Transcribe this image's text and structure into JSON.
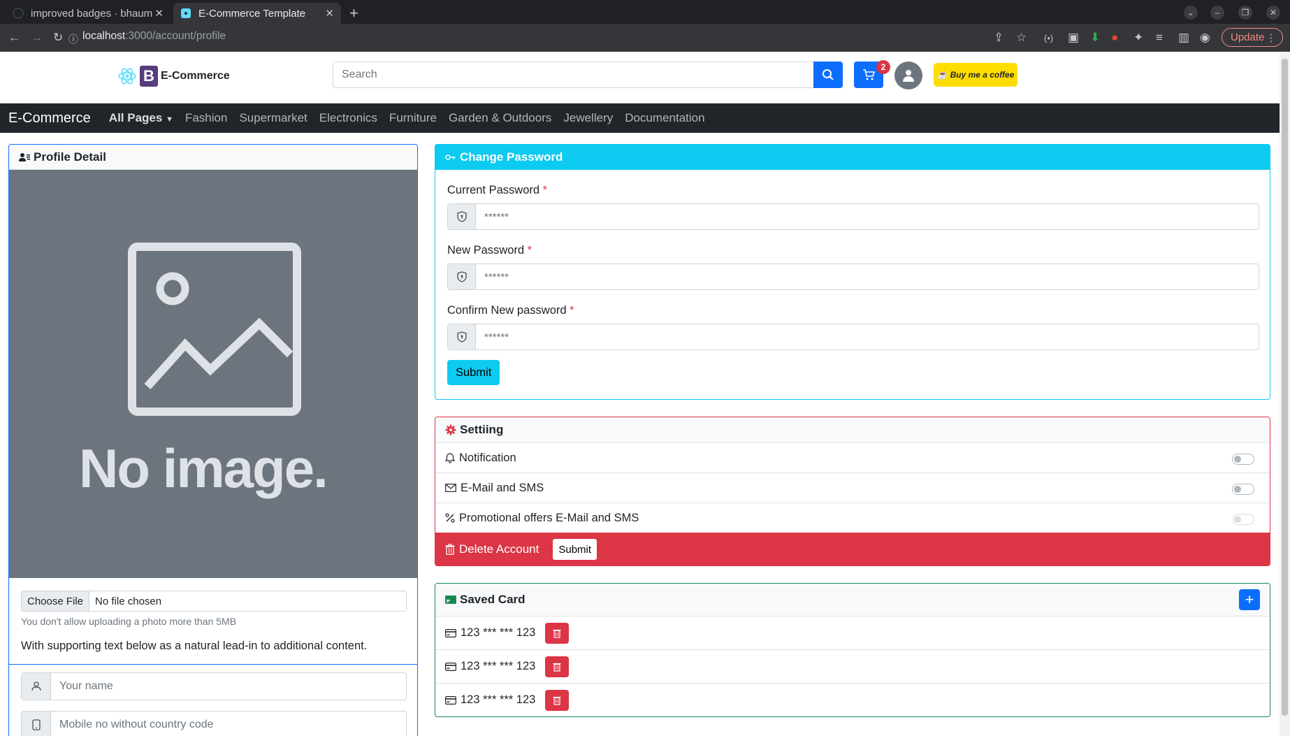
{
  "browser": {
    "tabs": [
      {
        "title": "improved badges · bhaum",
        "active": false
      },
      {
        "title": "E-Commerce Template",
        "active": true
      }
    ],
    "url_host": "localhost",
    "url_rest": ":3000/account/profile",
    "update_label": "Update"
  },
  "header": {
    "logo_letter": "B",
    "logo_text": "E-Commerce",
    "search_placeholder": "Search",
    "cart_count": "2",
    "coffee_label": "Buy me a coffee"
  },
  "nav": {
    "brand": "E-Commerce",
    "items": [
      "All Pages",
      "Fashion",
      "Supermarket",
      "Electronics",
      "Furniture",
      "Garden & Outdoors",
      "Jewellery",
      "Documentation"
    ]
  },
  "profile": {
    "title": "Profile Detail",
    "no_image_text": "No image.",
    "file_button": "Choose File",
    "file_status": "No file chosen",
    "file_hint": "You don't allow uploading a photo more than 5MB",
    "lead_text": "With supporting text below as a natural lead-in to additional content.",
    "name_placeholder": "Your name",
    "mobile_placeholder": "Mobile no without country code"
  },
  "password": {
    "title": "Change Password",
    "current_label": "Current Password",
    "new_label": "New Password",
    "confirm_label": "Confirm New password",
    "required_mark": "*",
    "placeholder": "******",
    "submit_label": "Submit"
  },
  "settings": {
    "title": "Settiing",
    "items": [
      {
        "label": "Notification",
        "enabled": false
      },
      {
        "label": "E-Mail and SMS",
        "enabled": false
      },
      {
        "label": "Promotional offers E-Mail and SMS",
        "enabled": false
      }
    ],
    "delete_label": "Delete Account",
    "delete_submit": "Submit"
  },
  "saved_cards": {
    "title": "Saved Card",
    "add_label": "+",
    "cards": [
      "123 *** *** 123",
      "123 *** *** 123",
      "123 *** *** 123"
    ]
  },
  "colors": {
    "primary": "#0d6efd",
    "info": "#0dcaf0",
    "danger": "#dc3545",
    "success": "#198754",
    "dark": "#212529",
    "secondary": "#6c757d",
    "coffee": "#ffdd00"
  }
}
